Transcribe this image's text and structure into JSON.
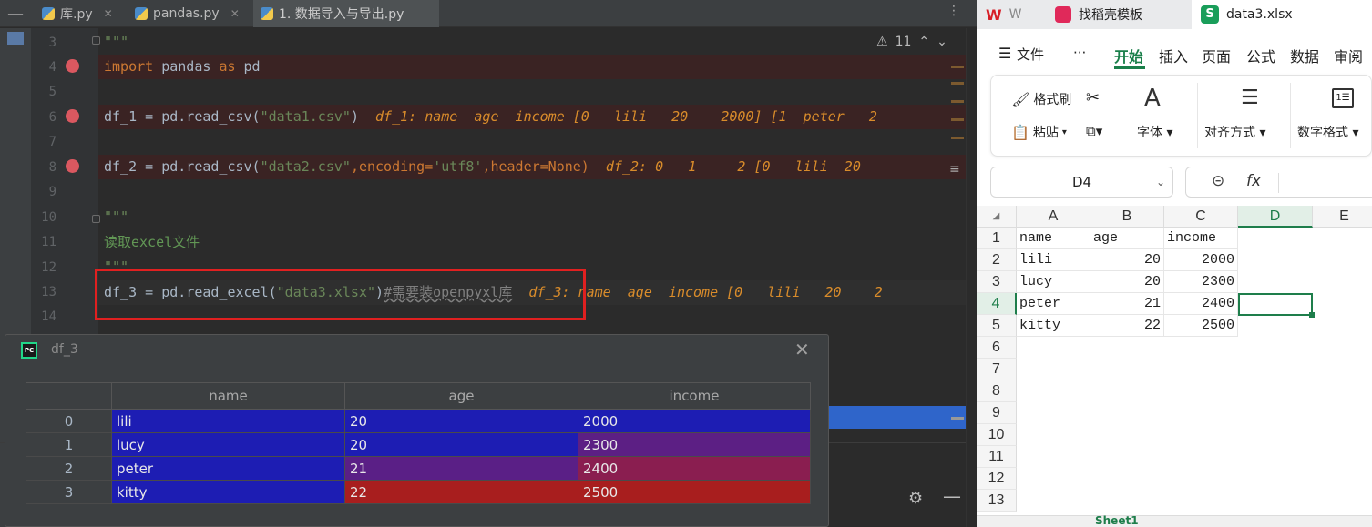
{
  "ide": {
    "tabs": [
      {
        "label": "库.py"
      },
      {
        "label": "pandas.py"
      },
      {
        "label": "1. 数据导入与导出.py"
      }
    ],
    "warnings_count": "11",
    "lines": [
      {
        "num": "3",
        "text": "\"\"\""
      },
      {
        "num": "4",
        "kw1": "import",
        "mid": " pandas ",
        "kw2": "as",
        "end": " pd"
      },
      {
        "num": "5"
      },
      {
        "num": "6",
        "pre": "df_1 = pd.read_csv(",
        "s": "\"data1.csv\"",
        "post": ")",
        "hint": "df_1: name  age  income [0   lili   20    2000] [1  peter   2"
      },
      {
        "num": "7"
      },
      {
        "num": "8",
        "pre": "df_2 = pd.read_csv(",
        "s": "\"data2.csv\"",
        "mid": ",encoding=",
        "s2": "'utf8'",
        "mid2": ",header=None)",
        "hint": "df_2: 0   1     2 [0   lili  20"
      },
      {
        "num": "9"
      },
      {
        "num": "10",
        "text": "\"\"\""
      },
      {
        "num": "11",
        "text": "读取excel文件"
      },
      {
        "num": "12",
        "text": "\"\"\""
      },
      {
        "num": "13",
        "pre": "df_3 = pd.read_excel(",
        "s": "\"data3.xlsx\"",
        "post": ")",
        "cmt": "#需要装openpyxl库",
        "hint": "df_3: name  age  income [0   lili   20    2"
      },
      {
        "num": "14"
      }
    ]
  },
  "popup": {
    "title": "df_3",
    "columns": [
      "name",
      "age",
      "income"
    ],
    "rows": [
      {
        "idx": "0",
        "name": "lili",
        "age": "20",
        "income": "2000"
      },
      {
        "idx": "1",
        "name": "lucy",
        "age": "20",
        "income": "2300"
      },
      {
        "idx": "2",
        "name": "peter",
        "age": "21",
        "income": "2400"
      },
      {
        "idx": "3",
        "name": "kitty",
        "age": "22",
        "income": "2500"
      }
    ],
    "colors": {
      "name": "#1d1db3",
      "age_low": "#1d1db3",
      "age_mid": "#5a1f86",
      "age_high": "#a81e1e",
      "inc_0": "#1d1db3",
      "inc_1": "#5c1f84",
      "inc_2": "#8a1e50",
      "inc_3": "#a81e1e"
    }
  },
  "wps": {
    "tabs": [
      {
        "label": "W"
      },
      {
        "label": "找稻壳模板"
      },
      {
        "label": "data3.xlsx"
      }
    ],
    "menu": [
      "文件",
      "···",
      "开始",
      "插入",
      "页面",
      "公式",
      "数据",
      "审阅"
    ],
    "ribbon": {
      "format_painter": "格式刷",
      "paste": "粘贴",
      "font": "字体",
      "align": "对齐方式",
      "number": "数字格式"
    },
    "name_box": "D4",
    "fx": "fx",
    "col_headers": [
      "A",
      "B",
      "C",
      "D",
      "E"
    ],
    "row_headers": [
      "1",
      "2",
      "3",
      "4",
      "5",
      "6",
      "7",
      "8",
      "9",
      "10",
      "11",
      "12",
      "13"
    ],
    "cells": {
      "header": [
        "name",
        "age",
        "income"
      ],
      "rows": [
        [
          "lili",
          "20",
          "2000"
        ],
        [
          "lucy",
          "20",
          "2300"
        ],
        [
          "peter",
          "21",
          "2400"
        ],
        [
          "kitty",
          "22",
          "2500"
        ]
      ]
    },
    "sheet_tab": "Sheet1"
  }
}
